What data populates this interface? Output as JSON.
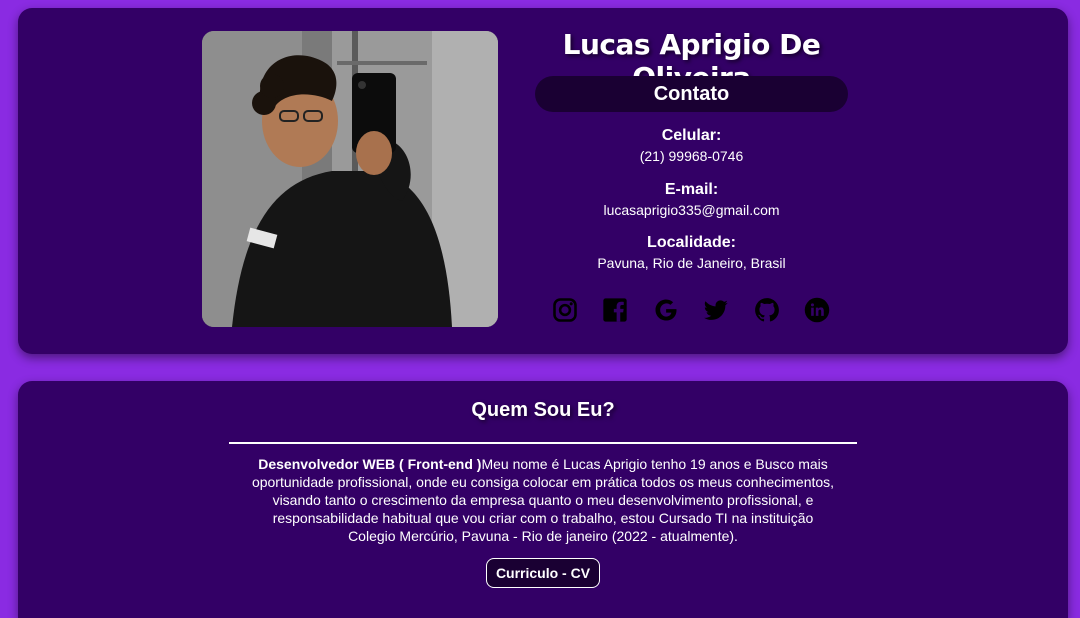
{
  "profile": {
    "name": "Lucas Aprigio De Oliveira",
    "photo_alt": "Lucas Aprigio De Oliveira"
  },
  "contact": {
    "heading": "Contato",
    "phone_label": "Celular:",
    "phone": "(21) 99968-0746",
    "email_label": "E-mail:",
    "email": "lucasaprigio335@gmail.com",
    "location_label": "Localidade:",
    "location": "Pavuna, Rio de Janeiro, Brasil"
  },
  "socials": [
    "instagram-icon",
    "facebook-icon",
    "google-icon",
    "twitter-icon",
    "github-icon",
    "linkedin-icon"
  ],
  "about": {
    "title": "Quem Sou Eu?",
    "role": "Desenvolvedor WEB ( Front-end )",
    "text": "Meu nome é Lucas Aprigio tenho 19 anos e Busco mais oportunidade profissional, onde eu consiga colocar em prática todos os meus conhecimentos, visando tanto o crescimento da empresa quanto o meu desenvolvimento profissional, e responsabilidade habitual que vou criar com o trabalho, estou Cursado TI na instituição Colegio Mercúrio, Pavuna - Rio de janeiro (2022 - atualmente).",
    "cv_button": "Curriculo - CV"
  },
  "colors": {
    "background": "#8a2be2",
    "card": "#330066",
    "pill": "#1a0033",
    "text": "#ffffff"
  }
}
